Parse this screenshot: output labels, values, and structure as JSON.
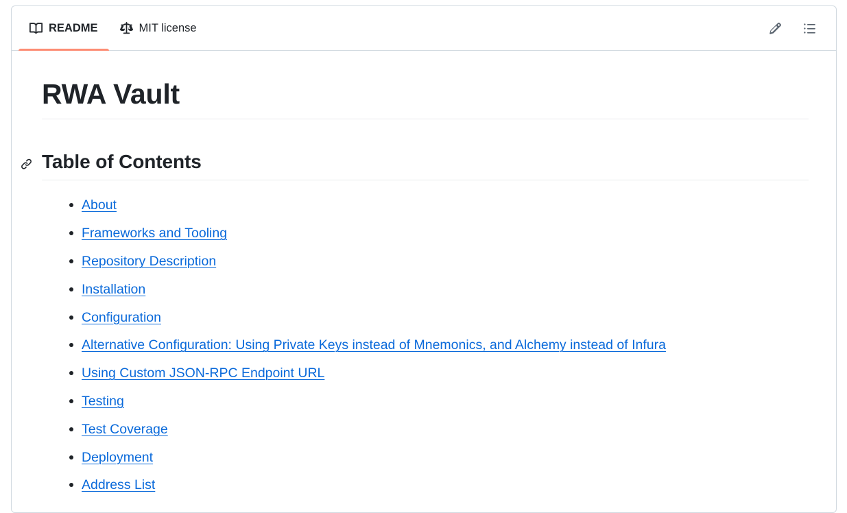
{
  "tabs": [
    {
      "id": "readme",
      "label": "README",
      "icon": "book-icon",
      "active": true
    },
    {
      "id": "license",
      "label": "MIT license",
      "icon": "law-scales-icon",
      "active": false
    }
  ],
  "actions": [
    {
      "id": "edit",
      "label": "Edit",
      "icon": "pencil-icon"
    },
    {
      "id": "outline",
      "label": "Outline",
      "icon": "list-unordered-icon"
    }
  ],
  "document": {
    "title": "RWA Vault",
    "toc_heading": "Table of Contents",
    "anchor_icon": "link-icon",
    "toc_items": [
      {
        "label": "About"
      },
      {
        "label": "Frameworks and Tooling"
      },
      {
        "label": "Repository Description"
      },
      {
        "label": "Installation"
      },
      {
        "label": "Configuration"
      },
      {
        "label": "Alternative Configuration: Using Private Keys instead of Mnemonics, and Alchemy instead of Infura"
      },
      {
        "label": "Using Custom JSON-RPC Endpoint URL"
      },
      {
        "label": "Testing"
      },
      {
        "label": "Test Coverage"
      },
      {
        "label": "Deployment"
      },
      {
        "label": "Address List"
      }
    ]
  },
  "colors": {
    "active_tab_underline": "#fd8c73",
    "link": "#0969da",
    "border": "#d1d9e0",
    "text": "#1f2328"
  }
}
